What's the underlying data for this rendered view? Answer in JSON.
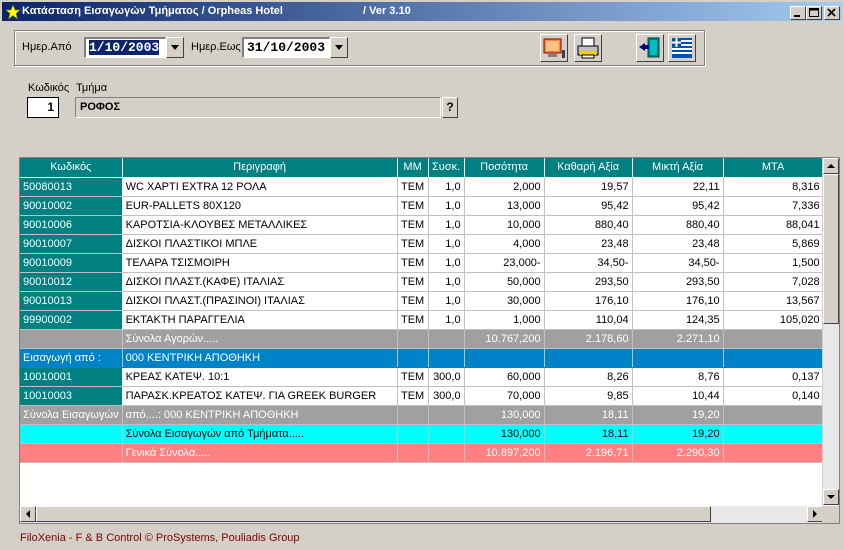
{
  "window": {
    "title": "Κατάσταση Εισαγωγών Τμήματος   / Orpheas Hotel",
    "version": "/ Ver  3.10",
    "minimize": "_",
    "maximize": "□",
    "close": "×"
  },
  "filters": {
    "from_label": "Ημερ.Από",
    "from_value": "1/10/2003",
    "to_label": "Ημερ.Εως",
    "to_value": "31/10/2003"
  },
  "department": {
    "code_label": "Κωδικός",
    "code_value": "1",
    "dept_label": "Τμήμα",
    "dept_value": "ΡΟΦΟΣ",
    "lookup": "?"
  },
  "grid": {
    "columns": [
      "Κωδικός",
      "Περιγραφή",
      "ΜΜ",
      "Συσκ.",
      "Ποσότητα",
      "Καθαρή Αξία",
      "Μικτή Αξία",
      "ΜΤΑ"
    ],
    "rows": [
      {
        "code": "50080013",
        "desc": "WC ΧΑΡΤΙ EXTRA 12 ΡΟΛΑ",
        "mm": "ΤΕΜ",
        "pack": "1,0",
        "qty": "2,000",
        "net": "19,57",
        "gross": "22,11",
        "mta": "8,316"
      },
      {
        "code": "90010002",
        "desc": "EUR-PALLETS 80X120",
        "mm": "ΤΕΜ",
        "pack": "1,0",
        "qty": "13,000",
        "net": "95,42",
        "gross": "95,42",
        "mta": "7,336"
      },
      {
        "code": "90010006",
        "desc": "ΚΑΡΟΤΣΙΑ-ΚΛΟΥΒΕΣ ΜΕΤΑΛΛΙΚΕΣ",
        "mm": "ΤΕΜ",
        "pack": "1,0",
        "qty": "10,000",
        "net": "880,40",
        "gross": "880,40",
        "mta": "88,041"
      },
      {
        "code": "90010007",
        "desc": "ΔΙΣΚΟΙ ΠΛΑΣΤΙΚΟΙ ΜΠΛΕ",
        "mm": "ΤΕΜ",
        "pack": "1,0",
        "qty": "4,000",
        "net": "23,48",
        "gross": "23,48",
        "mta": "5,869"
      },
      {
        "code": "90010009",
        "desc": "ΤΕΛΑΡΑ ΤΣΙΣΜΟΙΡΗ",
        "mm": "ΤΕΜ",
        "pack": "1,0",
        "qty": "23,000-",
        "net": "34,50-",
        "gross": "34,50-",
        "mta": "1,500"
      },
      {
        "code": "90010012",
        "desc": "ΔΙΣΚΟΙ ΠΛΑΣΤ.(ΚΑΦΕ) ΙΤΑΛΙΑΣ",
        "mm": "ΤΕΜ",
        "pack": "1,0",
        "qty": "50,000",
        "net": "293,50",
        "gross": "293,50",
        "mta": "7,028"
      },
      {
        "code": "90010013",
        "desc": "ΔΙΣΚΟΙ ΠΛΑΣΤ.(ΠΡΑΣΙΝΟΙ) ΙΤΑΛΙΑΣ",
        "mm": "ΤΕΜ",
        "pack": "1,0",
        "qty": "30,000",
        "net": "176,10",
        "gross": "176,10",
        "mta": "13,567"
      },
      {
        "code": "99900002",
        "desc": "ΕΚΤΑΚΤΗ ΠΑΡΑΓΓΕΛΙΑ",
        "mm": "ΤΕΜ",
        "pack": "1,0",
        "qty": "1,000",
        "net": "110,04",
        "gross": "124,35",
        "mta": "105,020"
      }
    ],
    "purchases_total": {
      "label": "Σύνολα Αγορών.....",
      "qty": "10.767,200",
      "net": "2.178,60",
      "gross": "2.271,10"
    },
    "import_header": {
      "code": "Εισαγωγή από :",
      "desc": "000 ΚΕΝΤΡΙΚΗ ΑΠΟΘΗΚΗ"
    },
    "import_rows": [
      {
        "code": "10010001",
        "desc": "ΚΡΕΑΣ ΚΑΤΕΨ. 10:1",
        "mm": "ΤΕΜ",
        "pack": "300,0",
        "qty": "60,000",
        "net": "8,26",
        "gross": "8,76",
        "mta": "0,137"
      },
      {
        "code": "10010003",
        "desc": "ΠΑΡΑΣΚ.ΚΡΕΑΤΟΣ ΚΑΤΕΨ. ΓΙΑ GREEK BURGER",
        "mm": "ΤΕΜ",
        "pack": "300,0",
        "qty": "70,000",
        "net": "9,85",
        "gross": "10,44",
        "mta": "0,140"
      }
    ],
    "imports_total": {
      "code": "Σύνολα Εισαγωγών",
      "desc": "από....: 000 ΚΕΝΤΡΙΚΗ ΑΠΟΘΗΚΗ",
      "qty": "130,000",
      "net": "18,11",
      "gross": "19,20"
    },
    "dept_imports_total": {
      "label": "Σύνολα Εισαγωγών από Τμήματα.....",
      "qty": "130,000",
      "net": "18,11",
      "gross": "19,20"
    },
    "grand_total": {
      "label": "Γενικά Σύνολα.....",
      "qty": "10.897,200",
      "net": "2.196,71",
      "gross": "2.290,30"
    }
  },
  "status": {
    "text": "FiloXenia - F & B Control  © ProSystems,  Pouliadis Group"
  }
}
